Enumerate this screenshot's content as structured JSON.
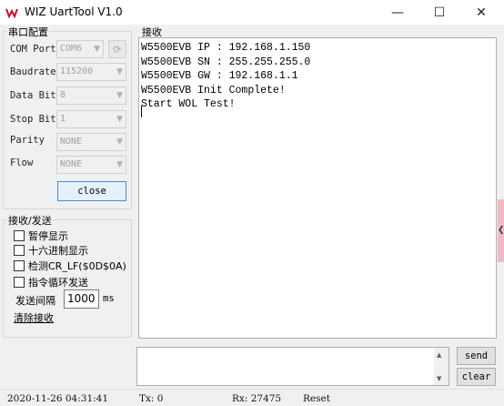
{
  "window": {
    "title": "WIZ UartTool V1.0",
    "minimize_glyph": "—",
    "maximize_glyph": "☐",
    "close_glyph": "✕",
    "logo_icon": "wiz-logo-icon"
  },
  "serial_config": {
    "group_title": "串口配置",
    "com_port": {
      "label": "COM Port",
      "value": "COM6"
    },
    "refresh_icon": "refresh-icon",
    "baudrate": {
      "label": "Baudrate",
      "value": "115200"
    },
    "data_bit": {
      "label": "Data Bit",
      "value": "8"
    },
    "stop_bit": {
      "label": "Stop Bit",
      "value": "1"
    },
    "parity": {
      "label": "Parity",
      "value": "NONE"
    },
    "flow": {
      "label": "Flow",
      "value": "NONE"
    },
    "close_button": "close"
  },
  "send_recv": {
    "group_title": "接收/发送",
    "options": [
      {
        "label": "暂停显示",
        "checked": false
      },
      {
        "label": "十六进制显示",
        "checked": false
      },
      {
        "label": "检测CR_LF($0D$0A)",
        "checked": false
      },
      {
        "label": "指令循环发送",
        "checked": false
      }
    ],
    "interval_label": "发送间隔",
    "interval_value": "1000",
    "interval_unit": "ms",
    "clear_recv": "清除接收"
  },
  "receive": {
    "group_title": "接收",
    "lines": [
      "W5500EVB IP : 192.168.1.150",
      "W5500EVB SN : 255.255.255.0",
      "W5500EVB GW : 192.168.1.1",
      "W5500EVB Init Complete!",
      "Start WOL Test!"
    ]
  },
  "send": {
    "text": "",
    "send_button": "send",
    "clear_button": "clear"
  },
  "status": {
    "datetime": "2020-11-26 04:31:41",
    "tx": "Tx: 0",
    "rx": "Rx: 27475",
    "reset": "Reset"
  },
  "colors": {
    "accent_border": "#3f8fd7",
    "side_tab": "#f2b8c4",
    "logo_red": "#c8102e"
  }
}
